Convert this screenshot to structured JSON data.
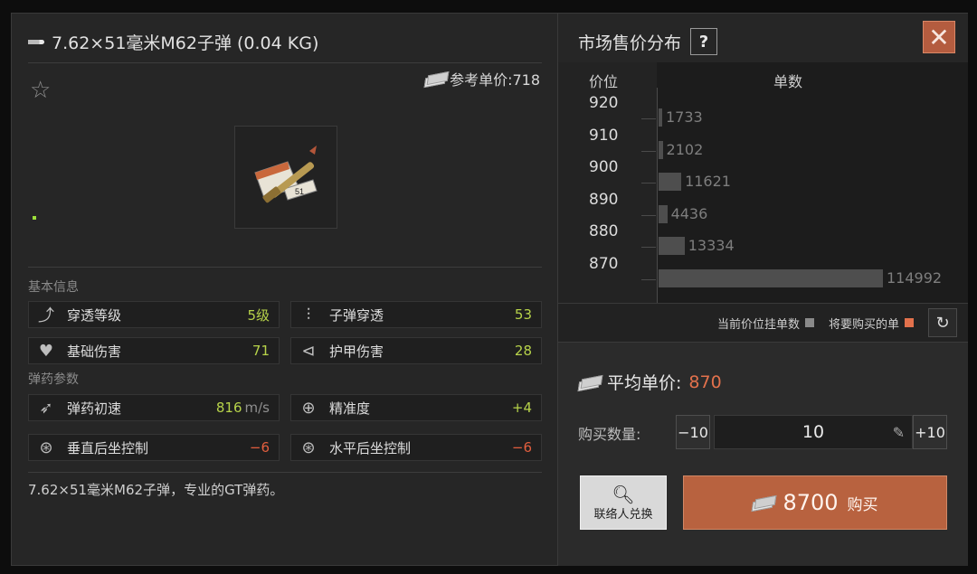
{
  "item": {
    "title": "7.62×51毫米M62子弹 (0.04 KG)",
    "ref_price_label": "参考单价:718",
    "description": "7.62×51毫米M62子弹，专业的GT弹药。"
  },
  "sections": {
    "basic": "基本信息",
    "ammo": "弹药参数"
  },
  "basic_stats": [
    {
      "label": "穿透等级",
      "value": "5级",
      "icon": "penetration-level-icon"
    },
    {
      "label": "子弹穿透",
      "value": "53",
      "icon": "bullet-penetration-icon"
    },
    {
      "label": "基础伤害",
      "value": "71",
      "icon": "broken-heart-icon"
    },
    {
      "label": "护甲伤害",
      "value": "28",
      "icon": "armor-damage-icon"
    }
  ],
  "ammo_stats": [
    {
      "label": "弹药初速",
      "value": "816",
      "unit": "m/s",
      "icon": "muzzle-velocity-icon"
    },
    {
      "label": "精准度",
      "value": "+4",
      "icon": "crosshair-icon"
    },
    {
      "label": "垂直后坐控制",
      "value": "−6",
      "icon": "vertical-recoil-icon"
    },
    {
      "label": "水平后坐控制",
      "value": "−6",
      "icon": "horizontal-recoil-icon"
    }
  ],
  "market": {
    "title": "市场售价分布",
    "help": "?",
    "col_price": "价位",
    "col_count": "单数",
    "legend_current": "当前价位挂单数",
    "legend_buy": "将要购买的单",
    "avg_label": "平均单价:",
    "avg_value": "870",
    "qty_label": "购买数量:",
    "qty_minus": "−10",
    "qty_value": "10",
    "qty_plus": "+10",
    "contact_label": "联络人兑换",
    "buy_total": "8700",
    "buy_label": "购买"
  },
  "colors": {
    "current": "#8a8a8a",
    "buy": "#e2714c",
    "positive": "#b7d34a",
    "negative": "#e25e3e"
  },
  "chart_data": {
    "type": "bar",
    "orientation": "horizontal",
    "categories": [
      "920",
      "910",
      "900",
      "890",
      "880",
      "870"
    ],
    "values": [
      1733,
      2102,
      11621,
      4436,
      13334,
      114992
    ],
    "xlabel": "单数",
    "ylabel": "价位"
  }
}
